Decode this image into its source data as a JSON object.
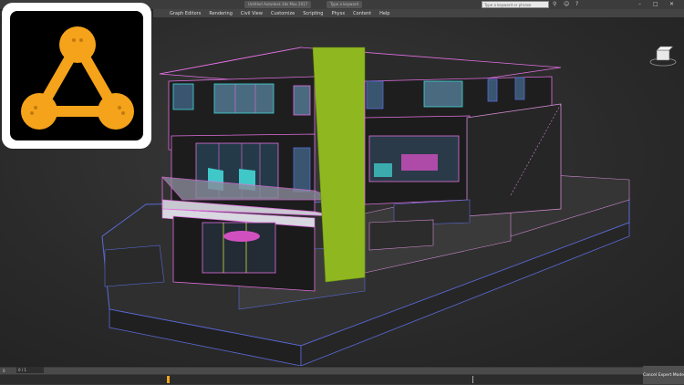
{
  "window": {
    "title_tab_1": "Untitled  Autodesk 3ds Max 2017",
    "title_tab_2": "Type a keyword",
    "search_placeholder": "Type a keyword or phrase"
  },
  "menu": {
    "items": [
      "Graph Editors",
      "Rendering",
      "Civil View",
      "Customize",
      "Scripting",
      "Physx",
      "Content",
      "Help"
    ]
  },
  "statusbar": {
    "frame_value": "0 / 1",
    "left_label": "0",
    "expert_mode": "Cancel Expert Mode"
  },
  "icons": {
    "logo": "triangle-node-logo",
    "viewcube": "viewcube-icon"
  },
  "colors": {
    "logo_orange": "#f5a31a",
    "accent_green": "#8fb820",
    "wire_magenta": "#e070e0",
    "wire_blue": "#5a6ad8",
    "wire_cyan": "#40d8d8"
  }
}
